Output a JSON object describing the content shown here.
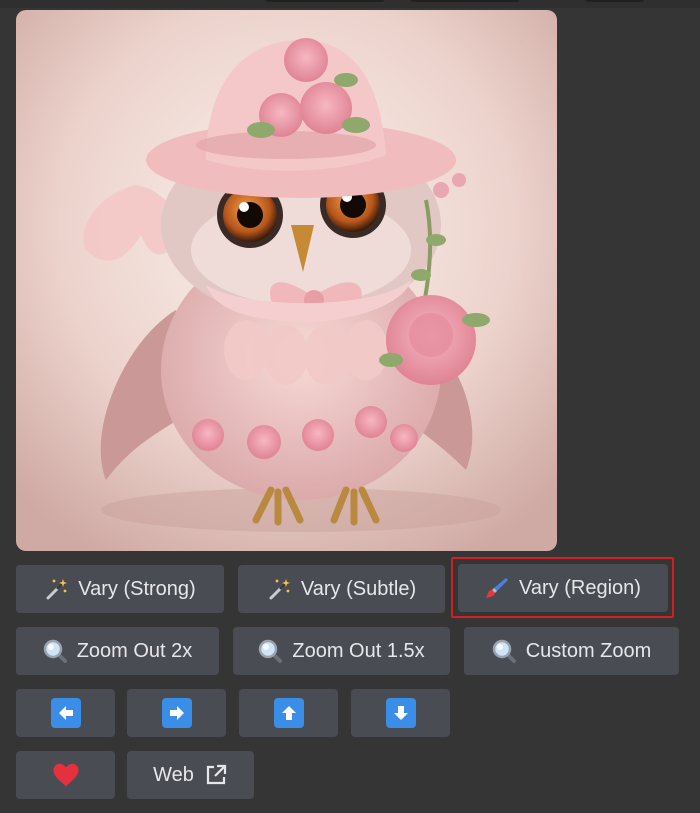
{
  "colors": {
    "background": "#353535",
    "button_bg": "#4a4c53",
    "button_text": "#e6e7ea",
    "highlight": "#d21f24",
    "arrow_blue": "#3a8ee8",
    "heart": "#e5303d"
  },
  "image": {
    "alt": "AI-generated pink owl illustration",
    "icon": "owl-image"
  },
  "vary_row": {
    "strong": {
      "label": "Vary (Strong)",
      "icon": "magic-wand-icon"
    },
    "subtle": {
      "label": "Vary (Subtle)",
      "icon": "magic-wand-icon"
    },
    "region": {
      "label": "Vary (Region)",
      "icon": "paintbrush-icon",
      "highlighted": true
    }
  },
  "zoom_row": {
    "out2x": {
      "label": "Zoom Out 2x",
      "icon": "magnifier-icon"
    },
    "out15x": {
      "label": "Zoom Out 1.5x",
      "icon": "magnifier-icon"
    },
    "custom": {
      "label": "Custom Zoom",
      "icon": "magnifier-icon"
    }
  },
  "pan_row": {
    "left": {
      "icon": "arrow-left-icon"
    },
    "right": {
      "icon": "arrow-right-icon"
    },
    "up": {
      "icon": "arrow-up-icon"
    },
    "down": {
      "icon": "arrow-down-icon"
    }
  },
  "misc_row": {
    "favorite": {
      "icon": "heart-icon"
    },
    "web": {
      "label": "Web",
      "icon": "external-link-icon"
    }
  }
}
